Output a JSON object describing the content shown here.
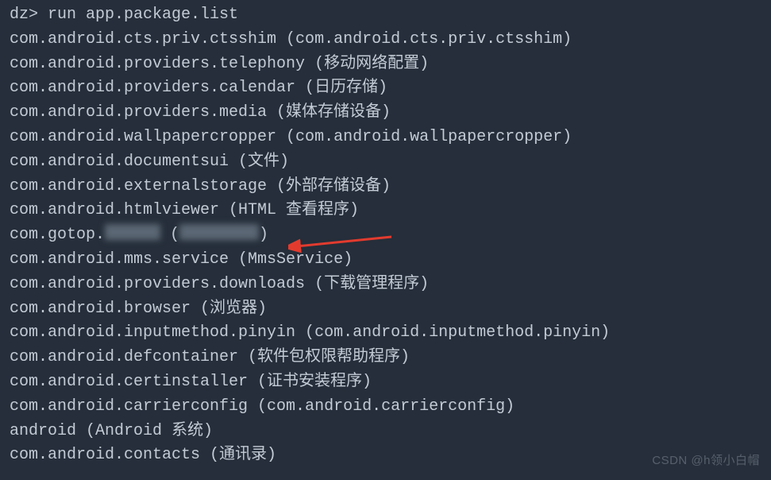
{
  "prompt": "dz> ",
  "command": "run app.package.list",
  "lines": [
    "com.android.cts.priv.ctsshim (com.android.cts.priv.ctsshim)",
    "com.android.providers.telephony (移动网络配置)",
    "com.android.providers.calendar (日历存储)",
    "com.android.providers.media (媒体存储设备)",
    "com.android.wallpapercropper (com.android.wallpapercropper)",
    "com.android.documentsui (文件)",
    "com.android.externalstorage (外部存储设备)",
    "com.android.htmlviewer (HTML 查看程序)"
  ],
  "redacted_prefix": "com.gotop.",
  "redacted_mid": " (",
  "redacted_suffix": ")",
  "lines2": [
    "com.android.mms.service (MmsService)",
    "com.android.providers.downloads (下载管理程序)",
    "com.android.browser (浏览器)",
    "com.android.inputmethod.pinyin (com.android.inputmethod.pinyin)",
    "com.android.defcontainer (软件包权限帮助程序)",
    "com.android.certinstaller (证书安装程序)",
    "com.android.carrierconfig (com.android.carrierconfig)",
    "android (Android 系统)",
    "com.android.contacts (通讯录)"
  ],
  "watermark": "CSDN @h领小白帽"
}
